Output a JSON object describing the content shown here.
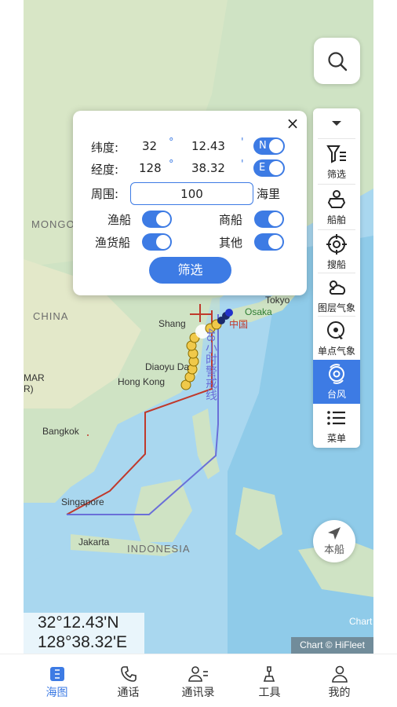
{
  "map": {
    "labels": {
      "mongolia": "MONGOLIA",
      "china": "CHINA",
      "shanghai": "Shang",
      "tokyo": "Tokyo",
      "osaka": "Osaka",
      "china_cn": "中国",
      "diaoyu": "Diaoyu Da",
      "hongkong": "Hong Kong",
      "mar": "MAR",
      "mar2": "R)",
      "bangkok": "Bangkok",
      "singapore": "Singapore",
      "jakarta": "Jakarta",
      "indonesia": "INDONESIA",
      "warning": "48小时警戒线",
      "chart_se": "Chart Se"
    },
    "copyright": "Chart © HiFleet"
  },
  "coords": {
    "lat": "32°12.43'N",
    "lon": "128°38.32'E"
  },
  "search": {
    "icon": "search-icon"
  },
  "toolbar": {
    "collapse_icon": "chevron-down-icon",
    "items": [
      {
        "label": "筛选",
        "icon": "filter-icon"
      },
      {
        "label": "船舶",
        "icon": "ship-icon"
      },
      {
        "label": "搜船",
        "icon": "target-icon"
      },
      {
        "label": "图层气象",
        "icon": "weather-layer-icon"
      },
      {
        "label": "单点气象",
        "icon": "point-weather-icon"
      },
      {
        "label": "台风",
        "icon": "typhoon-icon"
      },
      {
        "label": "菜单",
        "icon": "menu-icon"
      }
    ],
    "active": "台风"
  },
  "here": {
    "label": "本船"
  },
  "panel": {
    "close": "×",
    "lat_label": "纬度:",
    "lat_deg": "32",
    "lat_min": "12.43",
    "deg_symbol": "°",
    "min_symbol": "'",
    "lat_hemi": "N",
    "lon_label": "经度:",
    "lon_deg": "128",
    "lon_min": "38.32",
    "lon_hemi": "E",
    "range_label": "周围:",
    "range_value": "100",
    "range_unit": "海里",
    "fishing": "渔船",
    "merchant": "商船",
    "fish_cargo": "渔货船",
    "other": "其他",
    "filter_button": "筛选"
  },
  "bottomnav": {
    "items": [
      "海图",
      "通话",
      "通讯录",
      "工具",
      "我的"
    ],
    "active": "海图"
  },
  "colors": {
    "accent": "#3d7be4",
    "red_line": "#c0392b",
    "blue_line": "#6a6fd8"
  }
}
